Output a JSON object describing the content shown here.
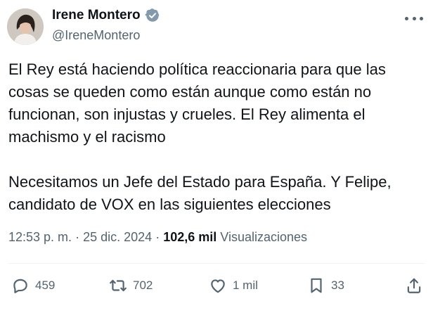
{
  "author": {
    "name": "Irene Montero",
    "handle": "@IreneMontero",
    "avatar_icon": "profile-photo",
    "verified_icon": "verified-badge-icon"
  },
  "tweet": {
    "paragraphs": [
      "El Rey está haciendo política reaccionaria para que las cosas se queden como están aunque como están no funcionan, son injustas y crueles. El Rey alimenta el machismo y el racismo",
      "Necesitamos un Jefe del Estado para España. Y Felipe, candidato de VOX en las siguientes elecciones"
    ]
  },
  "meta": {
    "time": "12:53 p. m.",
    "separator": "·",
    "date": "25 dic. 2024",
    "views_count": "102,6 mil",
    "views_label": "Visualizaciones"
  },
  "actions": {
    "replies": "459",
    "retweets": "702",
    "likes": "1 mil",
    "bookmarks": "33"
  },
  "colors": {
    "text": "#0f1419",
    "secondary": "#536471",
    "verified": "#829aab"
  }
}
